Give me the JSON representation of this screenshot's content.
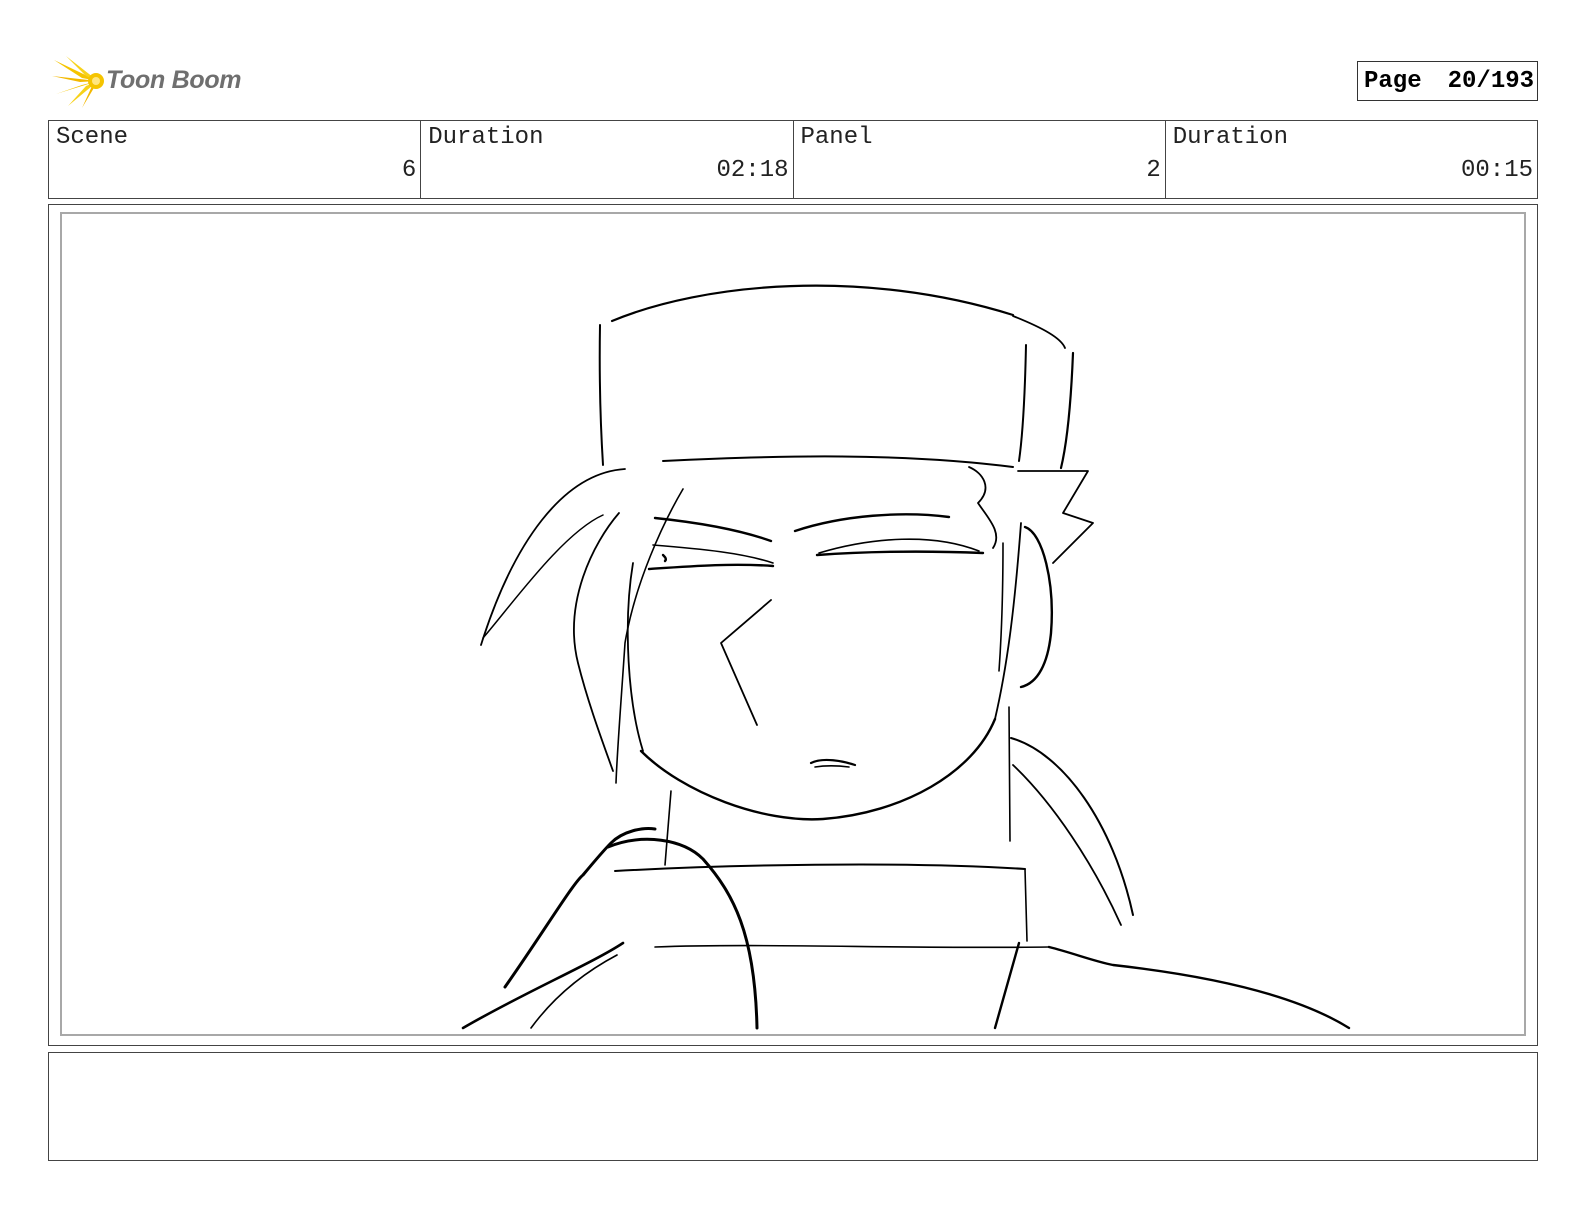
{
  "header": {
    "logo_text": "Toon Boom",
    "logo_color": "#f5c400",
    "page_label": "Page",
    "page_value": "20/193"
  },
  "info": {
    "scene_label": "Scene",
    "scene_value": "6",
    "scene_duration_label": "Duration",
    "scene_duration_value": "02:18",
    "panel_label": "Panel",
    "panel_value": "2",
    "panel_duration_label": "Duration",
    "panel_duration_value": "00:15"
  },
  "panel": {
    "image_description": "rough line sketch of a character wearing a tall hat"
  },
  "notes": {
    "text": ""
  }
}
